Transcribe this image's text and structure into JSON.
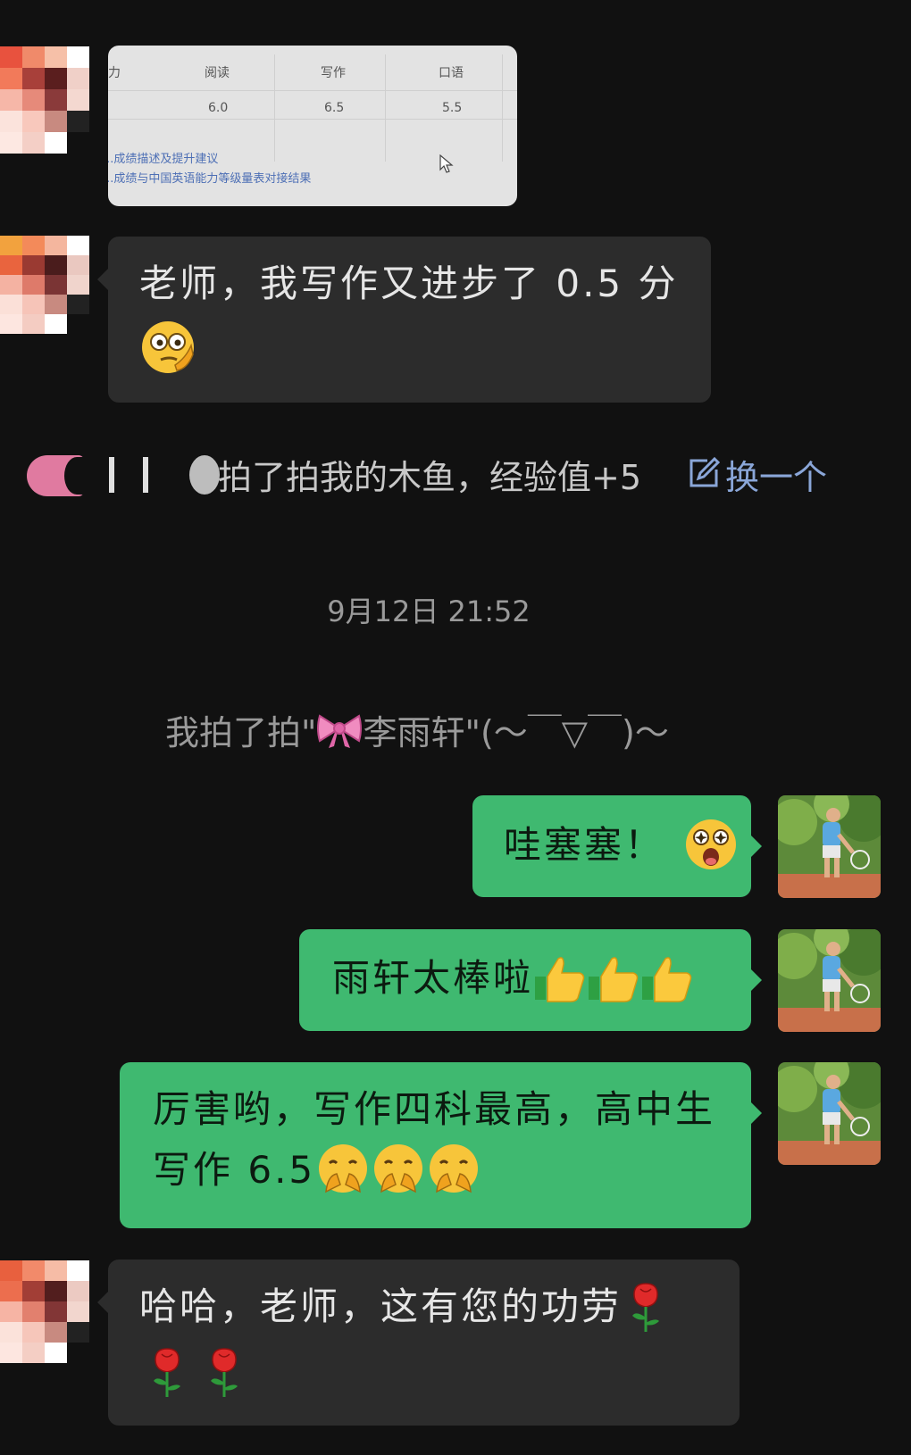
{
  "screenshot_table": {
    "headers": [
      "阅读",
      "写作",
      "口语"
    ],
    "values": [
      "6.0",
      "6.5",
      "5.5"
    ],
    "link_1": "...成绩描述及提升建议",
    "link_2": "...成绩与中国英语能力等级量表对接结果",
    "col_stub": "力"
  },
  "messages": [
    {
      "side": "in",
      "text_line1": "老师，我写作又进步了 0.5 分",
      "emoji": "thinking-face"
    },
    {
      "side": "out",
      "text": "哇塞塞！",
      "emoji": "starstruck-face"
    },
    {
      "side": "out",
      "text": "雨轩太棒啦",
      "emoji": "thumbs-up x3"
    },
    {
      "side": "out",
      "text_line1": "厉害哟，写作四科最高，高中生",
      "text_line2": "写作 6.5",
      "emoji": "shushing-face x3"
    },
    {
      "side": "in",
      "text_line1": "哈哈，老师，这有您的功劳",
      "emoji": "rose x3"
    }
  ],
  "system": {
    "pat_text": "拍了拍我的木鱼，经验值+5",
    "change_link": "换一个",
    "timestamp": "9月12日 21:52",
    "my_pat_prefix": "我拍了拍\"",
    "my_pat_name": "李雨轩",
    "my_pat_suffix": "\"(～￣▽￣)～"
  },
  "colors": {
    "background": "#111111",
    "incoming_bubble": "#2c2c2c",
    "outgoing_bubble": "#3fb970",
    "system_text": "#9a9a9a",
    "link": "#8aa6d8"
  }
}
